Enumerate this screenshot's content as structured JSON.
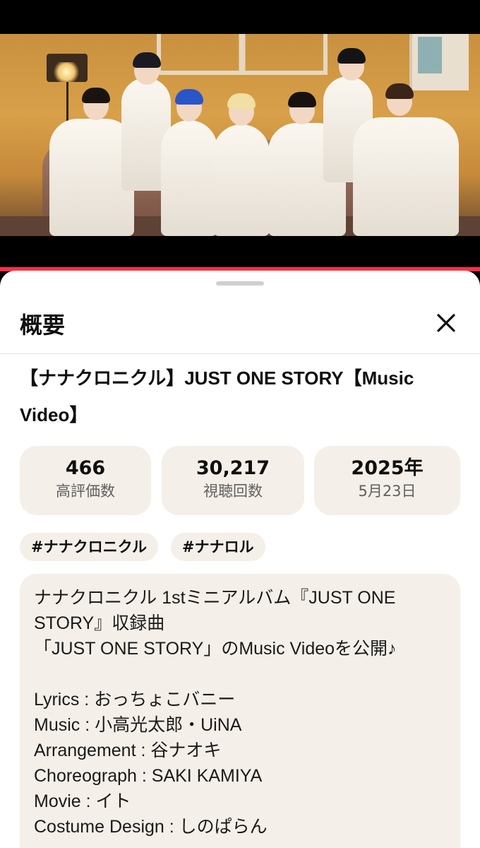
{
  "sheet": {
    "title": "概要",
    "close_icon": "close-icon"
  },
  "video": {
    "title": "【ナナクロニクル】JUST ONE STORY【Music Video】"
  },
  "stats": {
    "likes": {
      "value": "466",
      "label": "高評価数"
    },
    "views": {
      "value": "30,217",
      "label": "視聴回数"
    },
    "date": {
      "value": "2025年",
      "label": "5月23日"
    }
  },
  "tags": [
    "#ナナクロニクル",
    "#ナナロル"
  ],
  "description": {
    "lines": [
      "ナナクロニクル 1stミニアルバム『JUST ONE",
      "STORY』収録曲",
      "「JUST ONE STORY」のMusic Videoを公開♪",
      "",
      "Lyrics : おっちょこバニー",
      "Music : 小高光太郎・UiNA",
      "Arrangement : 谷ナオキ",
      "Choreograph : SAKI KAMIYA",
      "Movie : イト",
      "Costume Design : しのぱらん"
    ]
  },
  "colors": {
    "accent_bar": "#ff2f46",
    "card_bg": "#f4efe8"
  }
}
